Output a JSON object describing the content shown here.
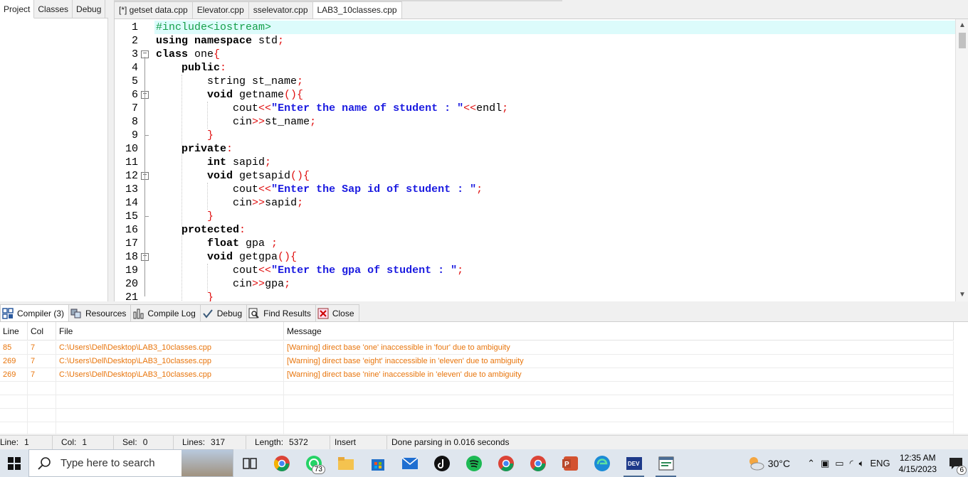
{
  "left_tabs": [
    "Project",
    "Classes",
    "Debug"
  ],
  "editor_tabs": [
    "[*] getset data.cpp",
    "Elevator.cpp",
    "sselevator.cpp",
    "LAB3_10classes.cpp"
  ],
  "code_lines": [
    {
      "n": "1"
    },
    {
      "n": "2"
    },
    {
      "n": "3"
    },
    {
      "n": "4"
    },
    {
      "n": "5"
    },
    {
      "n": "6"
    },
    {
      "n": "7"
    },
    {
      "n": "8"
    },
    {
      "n": "9"
    },
    {
      "n": "10"
    },
    {
      "n": "11"
    },
    {
      "n": "12"
    },
    {
      "n": "13"
    },
    {
      "n": "14"
    },
    {
      "n": "15"
    },
    {
      "n": "16"
    },
    {
      "n": "17"
    },
    {
      "n": "18"
    },
    {
      "n": "19"
    },
    {
      "n": "20"
    },
    {
      "n": "21"
    }
  ],
  "code_text": {
    "l1": "#include<iostream>",
    "l2_kw": "using namespace",
    "l2_rest": " std",
    "l3_kw": "class",
    "l3_rest": " one",
    "l4_kw": "public",
    "l5_rest": "string st_name",
    "l6_kw": "void",
    "l6_rest": " getname",
    "l7_a": "cout",
    "l7_s": "\"Enter the name of student : \"",
    "l7_b": "endl",
    "l8_a": "cin",
    "l8_b": "st_name",
    "l10_kw": "private",
    "l11_kw": "int",
    "l11_rest": " sapid",
    "l12_kw": "void",
    "l12_rest": " getsapid",
    "l13_a": "cout",
    "l13_s": "\"Enter the Sap id of student : \"",
    "l14_a": "cin",
    "l14_b": "sapid",
    "l16_kw": "protected",
    "l17_kw": "float",
    "l17_rest": " gpa ",
    "l18_kw": "void",
    "l18_rest": " getgpa",
    "l19_a": "cout",
    "l19_s": "\"Enter the gpa of student : \"",
    "l20_a": "cin",
    "l20_b": "gpa"
  },
  "bottom_tabs": [
    {
      "label": "Compiler (3)",
      "icon": "grid-icon"
    },
    {
      "label": "Resources",
      "icon": "resources-icon"
    },
    {
      "label": "Compile Log",
      "icon": "bar-chart-icon"
    },
    {
      "label": "Debug",
      "icon": "check-icon"
    },
    {
      "label": "Find Results",
      "icon": "find-icon"
    },
    {
      "label": "Close",
      "icon": "close-icon"
    }
  ],
  "messages": {
    "headers": [
      "Line",
      "Col",
      "File",
      "Message"
    ],
    "rows": [
      {
        "line": "85",
        "col": "7",
        "file": "C:\\Users\\Dell\\Desktop\\LAB3_10classes.cpp",
        "message": "[Warning] direct base 'one' inaccessible in 'four' due to ambiguity"
      },
      {
        "line": "269",
        "col": "7",
        "file": "C:\\Users\\Dell\\Desktop\\LAB3_10classes.cpp",
        "message": "[Warning] direct base 'eight' inaccessible in 'eleven' due to ambiguity"
      },
      {
        "line": "269",
        "col": "7",
        "file": "C:\\Users\\Dell\\Desktop\\LAB3_10classes.cpp",
        "message": "[Warning] direct base 'nine' inaccessible in 'eleven' due to ambiguity"
      }
    ],
    "warning_color": "#e8750c"
  },
  "status": {
    "line_label": "Line:",
    "line": "1",
    "col_label": "Col:",
    "col": "1",
    "sel_label": "Sel:",
    "sel": "0",
    "lines_label": "Lines:",
    "lines": "317",
    "length_label": "Length:",
    "length": "5372",
    "mode": "Insert",
    "message": "Done parsing in 0.016 seconds"
  },
  "taskbar": {
    "search_placeholder": "Type here to search",
    "whatsapp_badge": "73",
    "weather": "30°C",
    "lang": "ENG",
    "time": "12:35 AM",
    "date": "4/15/2023",
    "notif_badge": "6"
  }
}
